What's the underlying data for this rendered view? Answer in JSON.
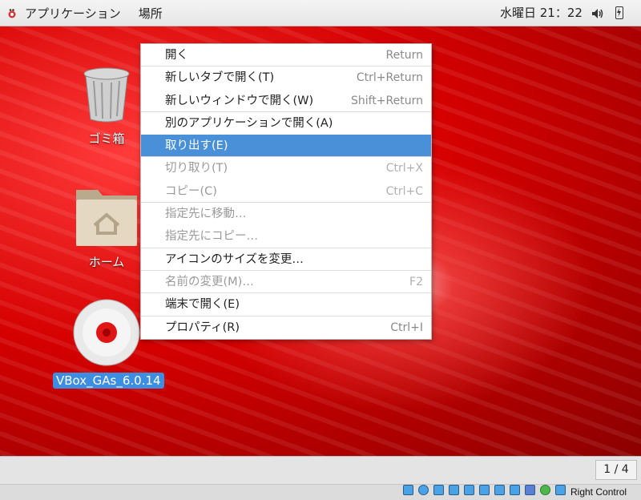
{
  "topbar": {
    "app_icon": "gnome-foot-icon",
    "applications": "アプリケーション",
    "places": "場所",
    "clock": "水曜日 21：22",
    "volume_icon": "speaker-icon",
    "battery_icon": "battery-charging-icon"
  },
  "desktop": {
    "icons": [
      {
        "label": "ゴミ箱",
        "icon": "trash-icon"
      },
      {
        "label": "ホーム",
        "icon": "home-folder-icon"
      },
      {
        "label": "VBox_GAs_6.0.14",
        "icon": "cd-disc-icon",
        "selected": true
      }
    ]
  },
  "context_menu": {
    "items": [
      {
        "label": "開く",
        "shortcut": "Return",
        "enabled": true
      },
      {
        "label": "新しいタブで開く(T)",
        "shortcut": "Ctrl+Return",
        "enabled": true
      },
      {
        "label": "新しいウィンドウで開く(W)",
        "shortcut": "Shift+Return",
        "enabled": true
      },
      {
        "label": "別のアプリケーションで開く(A)",
        "shortcut": "",
        "enabled": true
      },
      {
        "label": "取り出す(E)",
        "shortcut": "",
        "enabled": true,
        "highlighted": true
      },
      {
        "label": "切り取り(T)",
        "shortcut": "Ctrl+X",
        "enabled": false
      },
      {
        "label": "コピー(C)",
        "shortcut": "Ctrl+C",
        "enabled": false
      },
      {
        "label": "指定先に移動…",
        "shortcut": "",
        "enabled": false
      },
      {
        "label": "指定先にコピー…",
        "shortcut": "",
        "enabled": false
      },
      {
        "label": "アイコンのサイズを変更…",
        "shortcut": "",
        "enabled": true
      },
      {
        "label": "名前の変更(M)…",
        "shortcut": "F2",
        "enabled": false
      },
      {
        "label": "端末で開く(E)",
        "shortcut": "",
        "enabled": true
      },
      {
        "label": "プロパティ(R)",
        "shortcut": "Ctrl+I",
        "enabled": true
      }
    ]
  },
  "bottombar": {
    "workspace": "1 / 4"
  },
  "vbox_statusbar": {
    "host_key": "Right Control",
    "icons": [
      "hard-disk-icon",
      "optical-drive-icon",
      "audio-icon",
      "network-icon",
      "usb-icon",
      "shared-folder-icon",
      "display-icon",
      "video-capture-icon",
      "virtualization-icon",
      "mouse-integration-icon",
      "keyboard-icon"
    ]
  }
}
